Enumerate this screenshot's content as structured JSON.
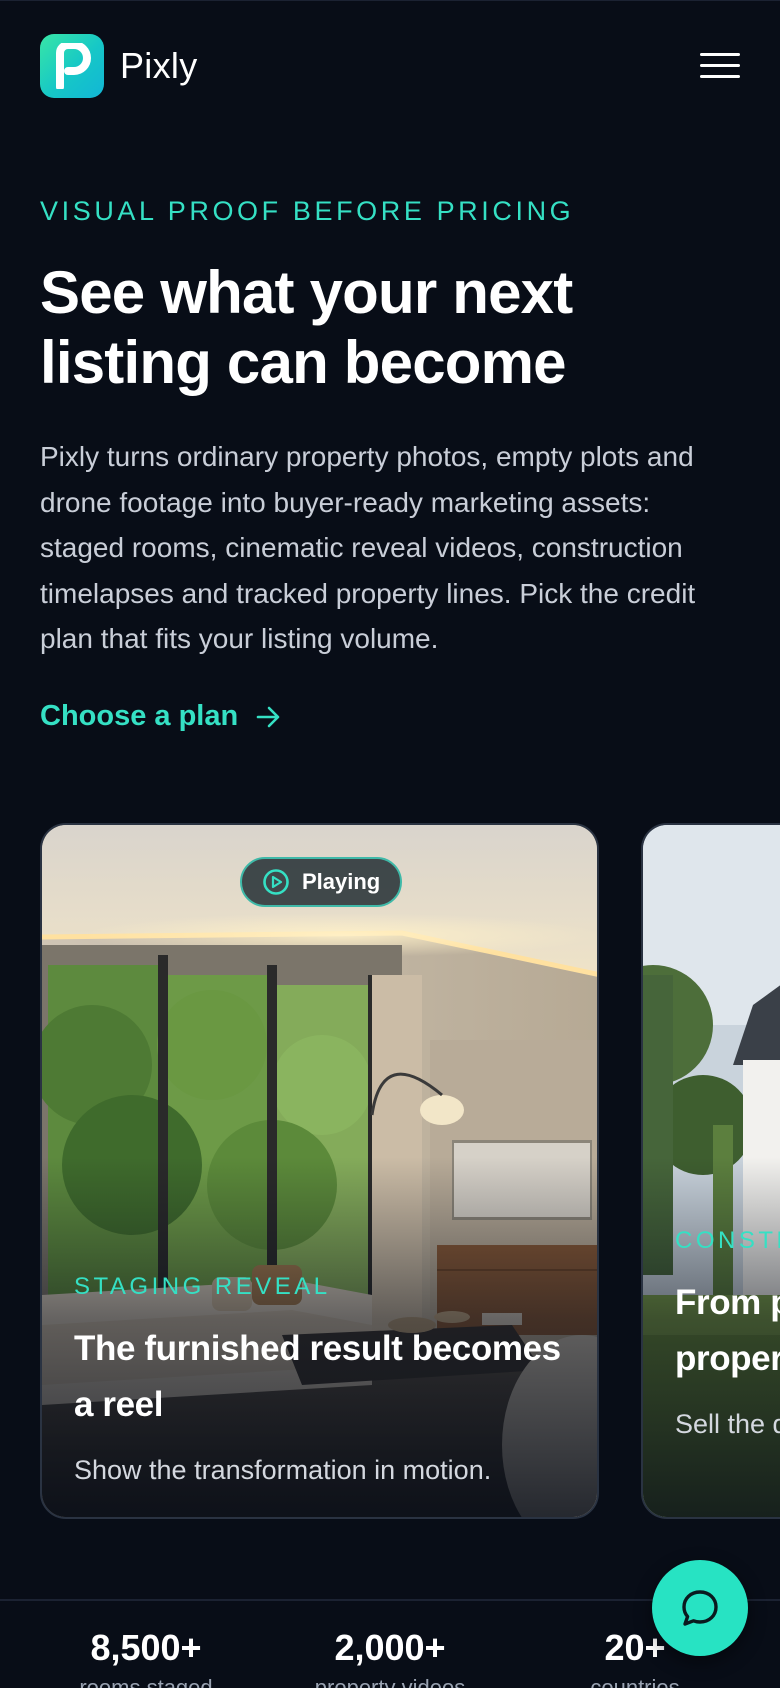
{
  "header": {
    "brand": "Pixly",
    "logo_icon": "pixly-logo-icon",
    "menu_icon": "hamburger-menu-icon"
  },
  "hero": {
    "eyebrow": "VISUAL PROOF BEFORE PRICING",
    "title": "See what your next listing can become",
    "description": "Pixly turns ordinary property photos, empty plots and drone footage into buyer-ready marketing assets: staged rooms, cinematic reveal videos, construction timelapses and tracked property lines. Pick the credit plan that fits your listing volume.",
    "cta_label": "Choose a plan",
    "cta_icon": "arrow-right-icon"
  },
  "cards": [
    {
      "status_label": "Playing",
      "status_icon": "play-circle-icon",
      "tag": "STAGING REVEAL",
      "title": "The furnished result becomes a reel",
      "description": "Show the transformation in motion."
    },
    {
      "tag": "CONSTR",
      "title": "From p\nproper",
      "description": "Sell the done."
    }
  ],
  "stats": [
    {
      "value": "8,500+",
      "label": "rooms staged"
    },
    {
      "value": "2,000+",
      "label": "property videos"
    },
    {
      "value": "20+",
      "label": "countries"
    }
  ],
  "chat": {
    "icon": "chat-bubble-icon"
  },
  "colors": {
    "background": "#080d17",
    "accent": "#35e0c4",
    "fab": "#27e3c3"
  }
}
